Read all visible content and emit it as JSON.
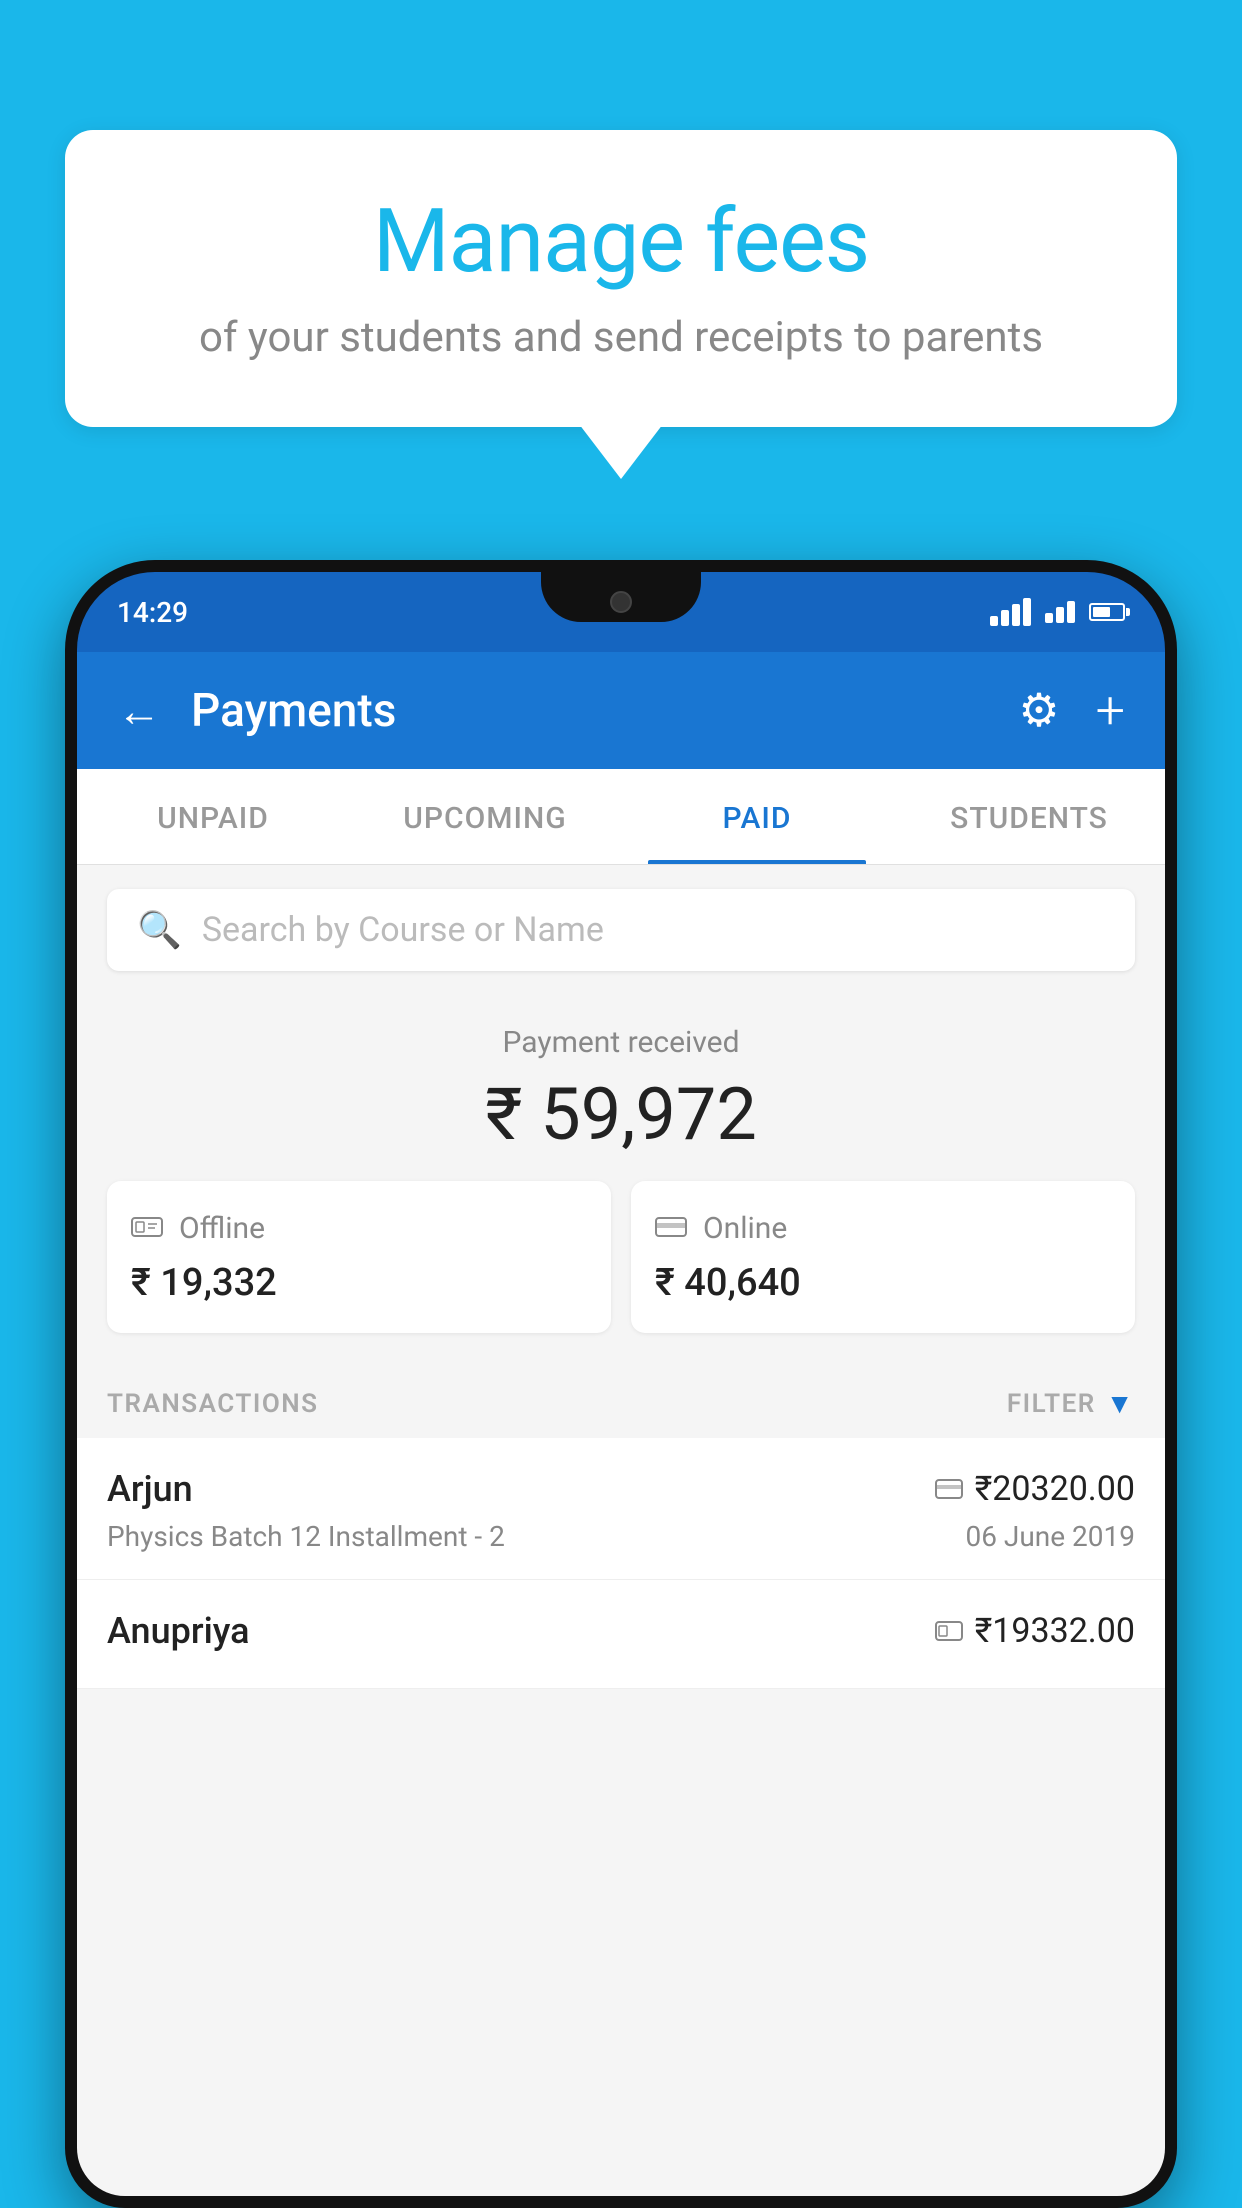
{
  "background_color": "#1ab7ea",
  "bubble": {
    "title": "Manage fees",
    "subtitle": "of your students and send receipts to parents"
  },
  "status_bar": {
    "time": "14:29"
  },
  "header": {
    "title": "Payments",
    "back_label": "←",
    "settings_label": "⚙",
    "add_label": "+"
  },
  "tabs": [
    {
      "label": "UNPAID",
      "active": false
    },
    {
      "label": "UPCOMING",
      "active": false
    },
    {
      "label": "PAID",
      "active": true
    },
    {
      "label": "STUDENTS",
      "active": false
    }
  ],
  "search": {
    "placeholder": "Search by Course or Name"
  },
  "payment_summary": {
    "label": "Payment received",
    "total": "₹ 59,972",
    "offline": {
      "label": "Offline",
      "amount": "₹ 19,332"
    },
    "online": {
      "label": "Online",
      "amount": "₹ 40,640"
    }
  },
  "transactions": {
    "section_label": "TRANSACTIONS",
    "filter_label": "FILTER",
    "rows": [
      {
        "name": "Arjun",
        "course": "Physics Batch 12 Installment - 2",
        "amount": "₹20320.00",
        "date": "06 June 2019",
        "payment_type": "card"
      },
      {
        "name": "Anupriya",
        "course": "",
        "amount": "₹19332.00",
        "date": "",
        "payment_type": "cash"
      }
    ]
  }
}
